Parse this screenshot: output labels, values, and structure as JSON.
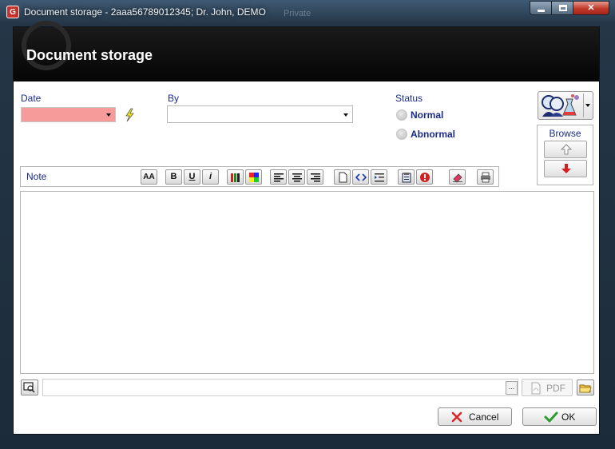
{
  "window": {
    "title": "Document storage - 2aaa56789012345; Dr. John, DEMO",
    "ghost_title": "Private",
    "app_icon_glyph": "G"
  },
  "banner": {
    "title": "Document storage"
  },
  "form": {
    "date_label": "Date",
    "date_value": "",
    "by_label": "By",
    "by_value": "",
    "status_label": "Status",
    "status_options": [
      "Normal",
      "Abnormal"
    ],
    "date_field_color": "#f79a9a"
  },
  "browse": {
    "label": "Browse"
  },
  "note": {
    "label": "Note",
    "toolbar": {
      "font": "AA",
      "bold": "B",
      "underline": "U",
      "italic": "i"
    },
    "content": ""
  },
  "bottom": {
    "path_value": "",
    "dots": "...",
    "pdf_label": "PDF",
    "cancel_label": "Cancel",
    "ok_label": "OK"
  },
  "colors": {
    "label_blue": "#1a2a8a",
    "cancel_x": "#d9262b",
    "ok_check": "#2e9b2e",
    "arrow_red": "#d62020"
  }
}
